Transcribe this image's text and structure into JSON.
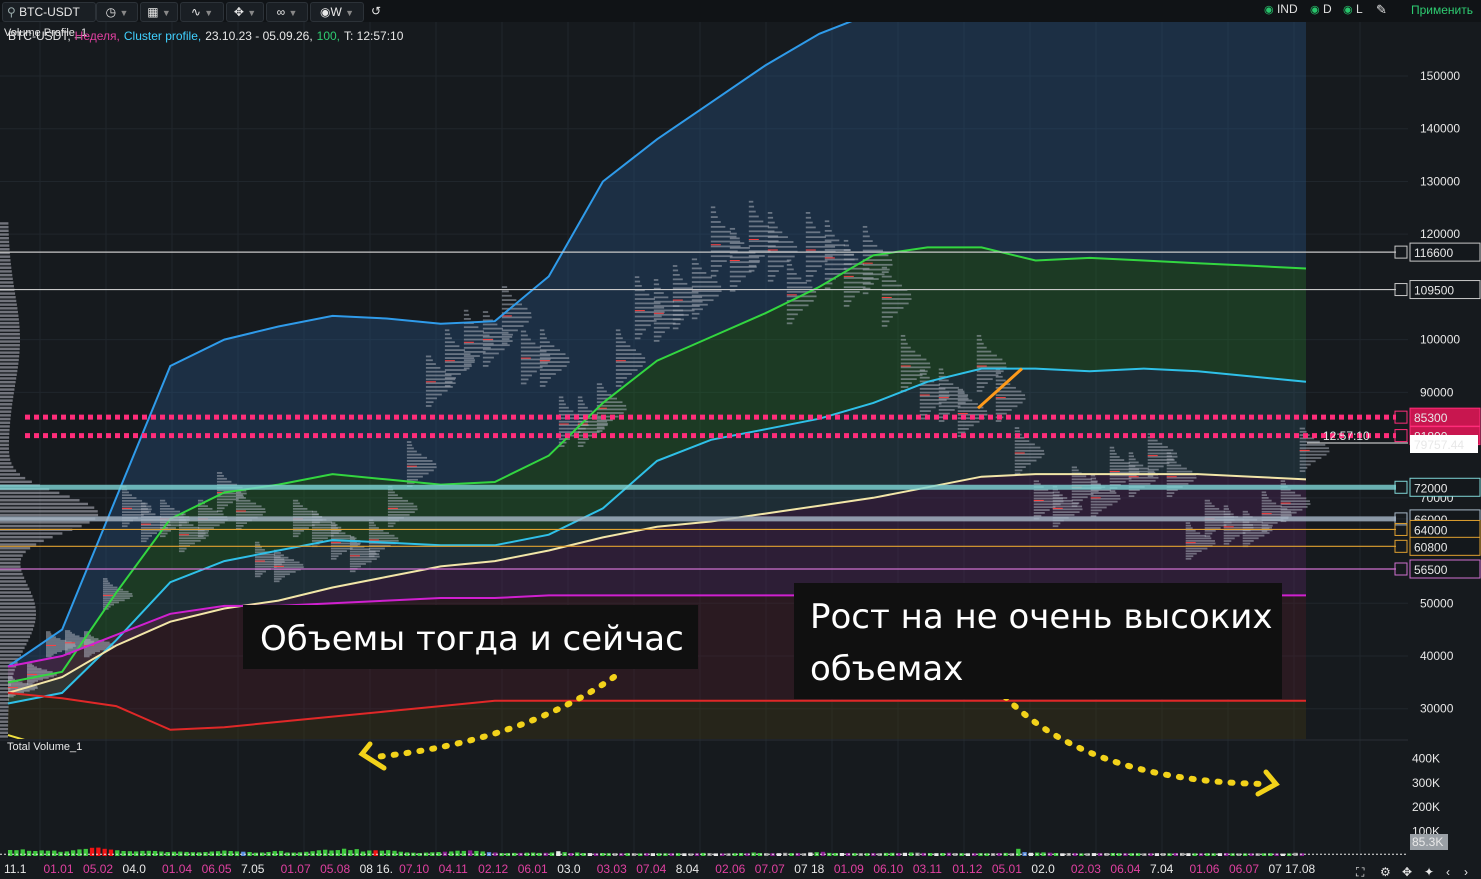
{
  "toolbar": {
    "symbol": "BTC-USDT",
    "timeframe": "W",
    "ind_label": "IND",
    "d_label": "D",
    "l_label": "L",
    "apply_label": "Применить"
  },
  "header": {
    "overlay_label": "Volume Profile_1",
    "symbol": "BTC-USDT,",
    "period": "Неделя,",
    "indicator": "Cluster profile,",
    "range": "23.10.23 - 05.09.26,",
    "value": "100,",
    "time": "T: 12:57:10"
  },
  "volume_panel_label": "Total Volume_1",
  "annotations": {
    "left": "Объемы тогда и сейчас",
    "right_line1": "Рост на не очень высоких",
    "right_line2": "объемах"
  },
  "price_axis": {
    "ticks": [
      "150000",
      "140000",
      "130000",
      "120000",
      "100000",
      "90000",
      "70000",
      "66000",
      "50000",
      "40000",
      "30000"
    ],
    "tick_values": [
      150000,
      140000,
      130000,
      120000,
      100000,
      90000,
      70000,
      66000,
      50000,
      40000,
      30000
    ]
  },
  "volume_axis": {
    "ticks": [
      "400K",
      "300K",
      "200K",
      "100K"
    ],
    "tick_values": [
      400000,
      300000,
      200000,
      100000
    ],
    "current_label": "85.3K",
    "current_value": 85300
  },
  "last_price": {
    "time": "12:57:10",
    "price": "79757.44",
    "value": 79757.44
  },
  "levels": [
    {
      "label": "116600",
      "value": 116600,
      "color": "#c8c8c8",
      "style": "thin"
    },
    {
      "label": "109500",
      "value": 109500,
      "color": "#c8c8c8",
      "style": "thin"
    },
    {
      "label": "85300",
      "value": 85300,
      "color": "#ff2d7a",
      "style": "dotted"
    },
    {
      "label": "81800",
      "value": 81800,
      "color": "#ff2d7a",
      "style": "dotted"
    },
    {
      "label": "72000",
      "value": 72000,
      "color": "#7fd6d6",
      "style": "band"
    },
    {
      "label": "66000",
      "value": 66000,
      "color": "#a8b8c8",
      "style": "band"
    },
    {
      "label": "64000",
      "value": 64000,
      "color": "#e0a030",
      "style": "thin"
    },
    {
      "label": "60800",
      "value": 60800,
      "color": "#e0a030",
      "style": "thin"
    },
    {
      "label": "56500",
      "value": 56500,
      "color": "#d070d0",
      "style": "thin"
    }
  ],
  "x_labels": [
    {
      "text": "11.1",
      "color": "#e8e8e8"
    },
    {
      "text": "01.01",
      "color": "#e040a0"
    },
    {
      "text": "05.02",
      "color": "#e040a0"
    },
    {
      "text": "04.0",
      "color": "#e8e8e8"
    },
    {
      "text": "01.04",
      "color": "#e040a0"
    },
    {
      "text": "06.05",
      "color": "#e040a0"
    },
    {
      "text": "7.05",
      "color": "#e8e8e8"
    },
    {
      "text": "01.07",
      "color": "#e040a0"
    },
    {
      "text": "05.08",
      "color": "#e040a0"
    },
    {
      "text": "08 16.",
      "color": "#e8e8e8"
    },
    {
      "text": "07.10",
      "color": "#e040a0"
    },
    {
      "text": "04.11",
      "color": "#e040a0"
    },
    {
      "text": "02.12",
      "color": "#e040a0"
    },
    {
      "text": "06.01",
      "color": "#e040a0"
    },
    {
      "text": "03.0",
      "color": "#e8e8e8"
    },
    {
      "text": "03.03",
      "color": "#e040a0"
    },
    {
      "text": "07.04",
      "color": "#e040a0"
    },
    {
      "text": "8.04",
      "color": "#e8e8e8"
    },
    {
      "text": "02.06",
      "color": "#e040a0"
    },
    {
      "text": "07.07",
      "color": "#e040a0"
    },
    {
      "text": "07 18",
      "color": "#e8e8e8"
    },
    {
      "text": "01.09",
      "color": "#e040a0"
    },
    {
      "text": "06.10",
      "color": "#e040a0"
    },
    {
      "text": "03.11",
      "color": "#e040a0"
    },
    {
      "text": "01.12",
      "color": "#e040a0"
    },
    {
      "text": "05.01",
      "color": "#e040a0"
    },
    {
      "text": "02.0",
      "color": "#e8e8e8"
    },
    {
      "text": "02.03",
      "color": "#e040a0"
    },
    {
      "text": "06.04",
      "color": "#e040a0"
    },
    {
      "text": "7.04",
      "color": "#e8e8e8"
    },
    {
      "text": "01.06",
      "color": "#e040a0"
    },
    {
      "text": "06.07",
      "color": "#e040a0"
    },
    {
      "text": "07 17.08",
      "color": "#e8e8e8"
    }
  ],
  "chart_data": {
    "type": "line",
    "symbol": "BTC-USDT",
    "timeframe": "Неделя",
    "price_range": [
      22000,
      162000
    ],
    "close_prices": [
      34000,
      37500,
      37000,
      36500,
      37000,
      41000,
      42000,
      44000,
      43500,
      42500,
      43000,
      43500,
      42000,
      43000,
      47000,
      51500,
      62000,
      61500,
      68000,
      70000,
      68500,
      65000,
      69500,
      67500,
      66000,
      63000,
      62500,
      63000,
      61500,
      64000,
      66000,
      67000,
      66500,
      71000,
      70500,
      69000,
      67500,
      63500,
      57000,
      58000,
      57500,
      59000,
      57000,
      63000,
      64500,
      66000,
      67000,
      67500,
      64000,
      62000,
      60500,
      61500,
      60000,
      57500,
      59000,
      61000,
      63000,
      62000,
      67000,
      66500,
      68000,
      69000,
      70000,
      76000,
      80000,
      88000,
      92000,
      91000,
      97500,
      96000,
      94500,
      99000,
      99500,
      97500,
      96000,
      100000,
      104000,
      106000,
      104500,
      102000,
      99000,
      96500,
      91000,
      95000,
      96000,
      95000,
      86000,
      84000,
      86000,
      82000,
      84000,
      83500,
      85000,
      87000,
      94000,
      95000,
      96000,
      104000,
      103000,
      105500,
      107000,
      106000,
      105000,
      108000,
      109000,
      107500,
      105000,
      108000,
      109500,
      115000,
      118500,
      118000,
      119000,
      117000,
      115000,
      117000,
      114500,
      119000,
      118000,
      116000,
      117000,
      110000,
      109000,
      108500,
      111000,
      113000,
      117000,
      122000,
      121000,
      115500,
      113000,
      111000,
      112000,
      110000,
      114000,
      114500,
      110500,
      108500,
      108000,
      104000,
      101500,
      95000,
      91000,
      88000,
      89500,
      91000,
      88000,
      89000,
      90000,
      87500,
      86000,
      91000,
      92500,
      95000,
      94500,
      92500,
      89000,
      84000,
      77000,
      78500,
      70000,
      68500,
      69500,
      70000,
      66000,
      68000,
      69000,
      67000,
      72000,
      73000,
      71000,
      70000,
      66000,
      68500,
      75000,
      80500,
      77500,
      74000,
      73000,
      71000,
      78000,
      79500,
      76000,
      74000,
      71000,
      63500,
      61500,
      62500,
      64000,
      66000,
      63000,
      61000,
      64500,
      65000,
      67000,
      64000,
      63500,
      65000,
      67000,
      66000,
      68000,
      69000,
      72000,
      76000,
      79000,
      79757
    ],
    "bb_upper": [
      38000,
      45000,
      70000,
      95000,
      100000,
      102500,
      104500,
      104000,
      103000,
      103500,
      112000,
      130000,
      138000,
      145000,
      152000,
      158000,
      162000,
      162000,
      162000,
      162000,
      162000,
      162000,
      162000,
      162000,
      162000
    ],
    "bb_middle": [
      35000,
      37000,
      52000,
      66000,
      71000,
      72500,
      74500,
      73500,
      72500,
      73000,
      78000,
      88000,
      96000,
      100500,
      105000,
      110000,
      116000,
      117500,
      117500,
      115000,
      115500,
      115000,
      114500,
      114000,
      113500
    ],
    "bb_lower": [
      31000,
      33000,
      43000,
      54000,
      58000,
      60000,
      62000,
      61500,
      61000,
      61000,
      63000,
      68000,
      77000,
      81000,
      83000,
      85000,
      88000,
      92000,
      94500,
      94500,
      94000,
      94500,
      94000,
      93000,
      92000
    ],
    "yellow_line": [
      33000,
      36000,
      42000,
      46500,
      49000,
      50500,
      53000,
      55000,
      57000,
      58000,
      60000,
      62500,
      64500,
      65500,
      67000,
      68500,
      70000,
      72000,
      74000,
      74500,
      74500,
      74500,
      74500,
      74000,
      73500
    ],
    "magenta_line": [
      38000,
      40000,
      44000,
      48000,
      49500,
      49500,
      50000,
      50500,
      51000,
      51000,
      51500,
      51500,
      51500,
      51500,
      51500,
      51500,
      51500,
      51500,
      51500,
      51500,
      51500,
      51500,
      51500,
      51500,
      51500
    ],
    "red_line": [
      33000,
      32000,
      30500,
      26000,
      26500,
      27500,
      28500,
      29500,
      30500,
      31500,
      31500,
      31500,
      31500,
      31500,
      31500,
      31500,
      31500,
      31500,
      31500,
      31500,
      31500,
      31500,
      31500,
      31500,
      31500
    ],
    "yellow_lower": [
      25000,
      22000,
      21000,
      21000,
      21000,
      21000,
      21000,
      21000,
      21000,
      21000,
      21000,
      21000,
      21000,
      21000,
      21000,
      21000,
      21000,
      21000,
      21000,
      21000,
      21000,
      21000,
      21000,
      21000,
      21000
    ],
    "volume": [
      300,
      290,
      330,
      260,
      250,
      280,
      265,
      270,
      210,
      230,
      285,
      330,
      355,
      410,
      420,
      360,
      320,
      285,
      250,
      240,
      230,
      255,
      260,
      250,
      225,
      200,
      215,
      220,
      205,
      190,
      185,
      200,
      225,
      240,
      270,
      250,
      230,
      215,
      200,
      165,
      175,
      200,
      245,
      255,
      175,
      170,
      185,
      210,
      240,
      285,
      315,
      275,
      295,
      365,
      295,
      345,
      225,
      275,
      285,
      265,
      290,
      260,
      215,
      180,
      165,
      150,
      170,
      185,
      200,
      215,
      230,
      265,
      255,
      280,
      255,
      230,
      190,
      175,
      145,
      145,
      155,
      155,
      165,
      170,
      155,
      160,
      175,
      240,
      195,
      150,
      175,
      150,
      145,
      135,
      150,
      140,
      140,
      135,
      145,
      140,
      130,
      145,
      140,
      135,
      135,
      140,
      140,
      135,
      130,
      135,
      155,
      145,
      130,
      130,
      135,
      140,
      150,
      140,
      175,
      150,
      145,
      140,
      140,
      160,
      145,
      145,
      140,
      175,
      190,
      210,
      155,
      150,
      150,
      150,
      145,
      140,
      140,
      145,
      140,
      155,
      160,
      145,
      160,
      175,
      165,
      155,
      150,
      140,
      150,
      160,
      145,
      140,
      135,
      140,
      145,
      135,
      140,
      150,
      155,
      140,
      360,
      195,
      160,
      170,
      180,
      165,
      150,
      135,
      150,
      145,
      130,
      140,
      145,
      145,
      150,
      150,
      140,
      140,
      140,
      140,
      135,
      140,
      140,
      145,
      135,
      150,
      155,
      140,
      135,
      135,
      140,
      135,
      140,
      150,
      135,
      130,
      130,
      135,
      135,
      135,
      140,
      130,
      120,
      130,
      160,
      135
    ],
    "volume_colors_note": "green up weeks, red/blue highlighted spikes, purple/white/grey later weeks"
  }
}
